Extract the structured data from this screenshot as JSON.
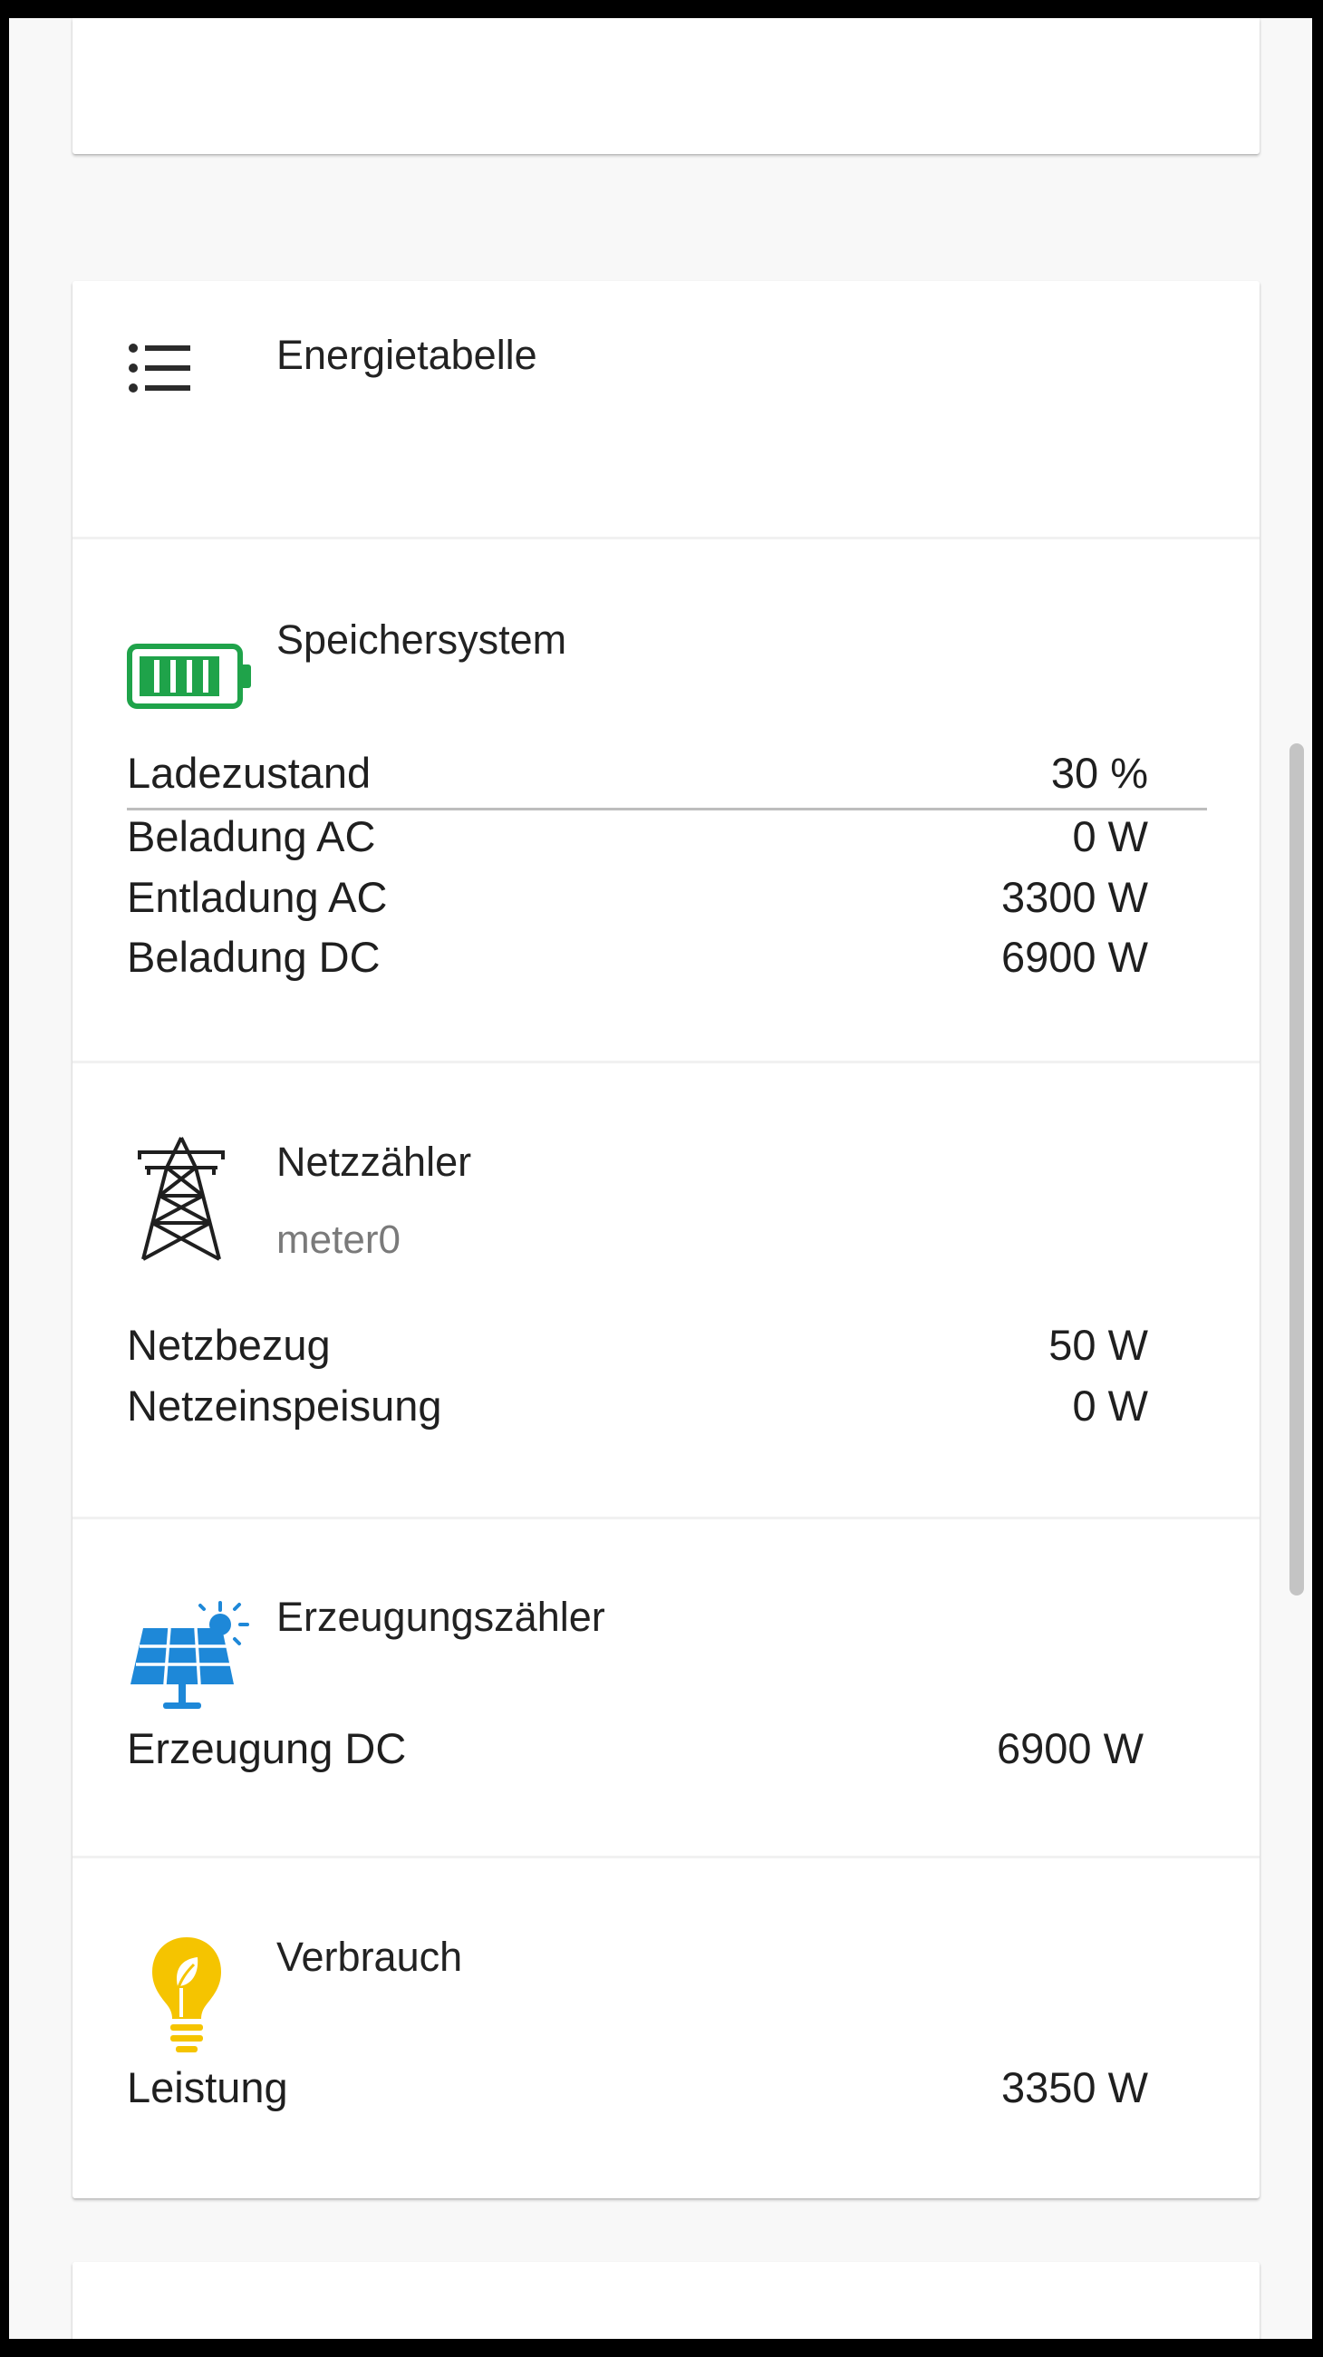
{
  "header": {
    "title": "Energietabelle",
    "icon": "list-icon"
  },
  "storage": {
    "title": "Speichersystem",
    "icon": "battery-icon",
    "color": "#1fa34a",
    "rows": [
      {
        "label": "Ladezustand",
        "value": "30 %"
      },
      {
        "label": "Beladung AC",
        "value": "0 W"
      },
      {
        "label": "Entladung AC",
        "value": "3300 W"
      },
      {
        "label": "Beladung DC",
        "value": "6900 W"
      }
    ]
  },
  "grid": {
    "title": "Netzzähler",
    "subtitle": "meter0",
    "icon": "power-tower-icon",
    "rows": [
      {
        "label": "Netzbezug",
        "value": "50 W"
      },
      {
        "label": "Netzeinspeisung",
        "value": "0 W"
      }
    ]
  },
  "generation": {
    "title": "Erzeugungszähler",
    "icon": "solar-panel-icon",
    "color": "#1e88d8",
    "rows": [
      {
        "label": "Erzeugung DC",
        "value": "6900 W"
      }
    ]
  },
  "consumption": {
    "title": "Verbrauch",
    "icon": "lightbulb-icon",
    "color": "#f5c400",
    "rows": [
      {
        "label": "Leistung",
        "value": "3350 W"
      }
    ]
  }
}
